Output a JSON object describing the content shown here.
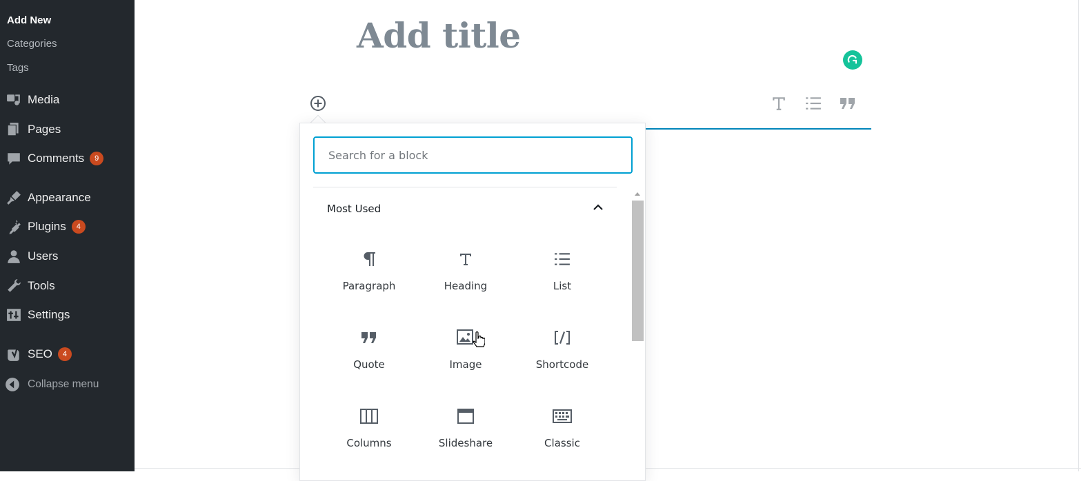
{
  "sidebar": {
    "subitems": [
      {
        "label": "Add New"
      },
      {
        "label": "Categories"
      },
      {
        "label": "Tags"
      }
    ],
    "items": [
      {
        "label": "Media",
        "icon": "media-icon"
      },
      {
        "label": "Pages",
        "icon": "pages-icon"
      },
      {
        "label": "Comments",
        "icon": "comments-icon",
        "badge": "9"
      },
      {
        "label": "Appearance",
        "icon": "appearance-icon"
      },
      {
        "label": "Plugins",
        "icon": "plugins-icon",
        "badge": "4"
      },
      {
        "label": "Users",
        "icon": "users-icon"
      },
      {
        "label": "Tools",
        "icon": "tools-icon"
      },
      {
        "label": "Settings",
        "icon": "settings-icon"
      },
      {
        "label": "SEO",
        "icon": "seo-icon",
        "badge": "4"
      }
    ],
    "collapse_label": "Collapse menu"
  },
  "editor": {
    "title_placeholder": "Add title"
  },
  "inserter": {
    "search_placeholder": "Search for a block",
    "panel_title": "Most Used",
    "blocks": [
      {
        "label": "Paragraph",
        "icon": "paragraph-icon"
      },
      {
        "label": "Heading",
        "icon": "heading-icon"
      },
      {
        "label": "List",
        "icon": "list-icon"
      },
      {
        "label": "Quote",
        "icon": "quote-icon"
      },
      {
        "label": "Image",
        "icon": "image-icon"
      },
      {
        "label": "Shortcode",
        "icon": "shortcode-icon"
      },
      {
        "label": "Columns",
        "icon": "columns-icon"
      },
      {
        "label": "Slideshare",
        "icon": "slideshare-icon"
      },
      {
        "label": "Classic",
        "icon": "keyboard-icon"
      }
    ]
  },
  "colors": {
    "sidebar_bg": "#23282d",
    "badge": "#ca4a1f",
    "accent": "#0085ba",
    "grammarly": "#15c39a"
  }
}
